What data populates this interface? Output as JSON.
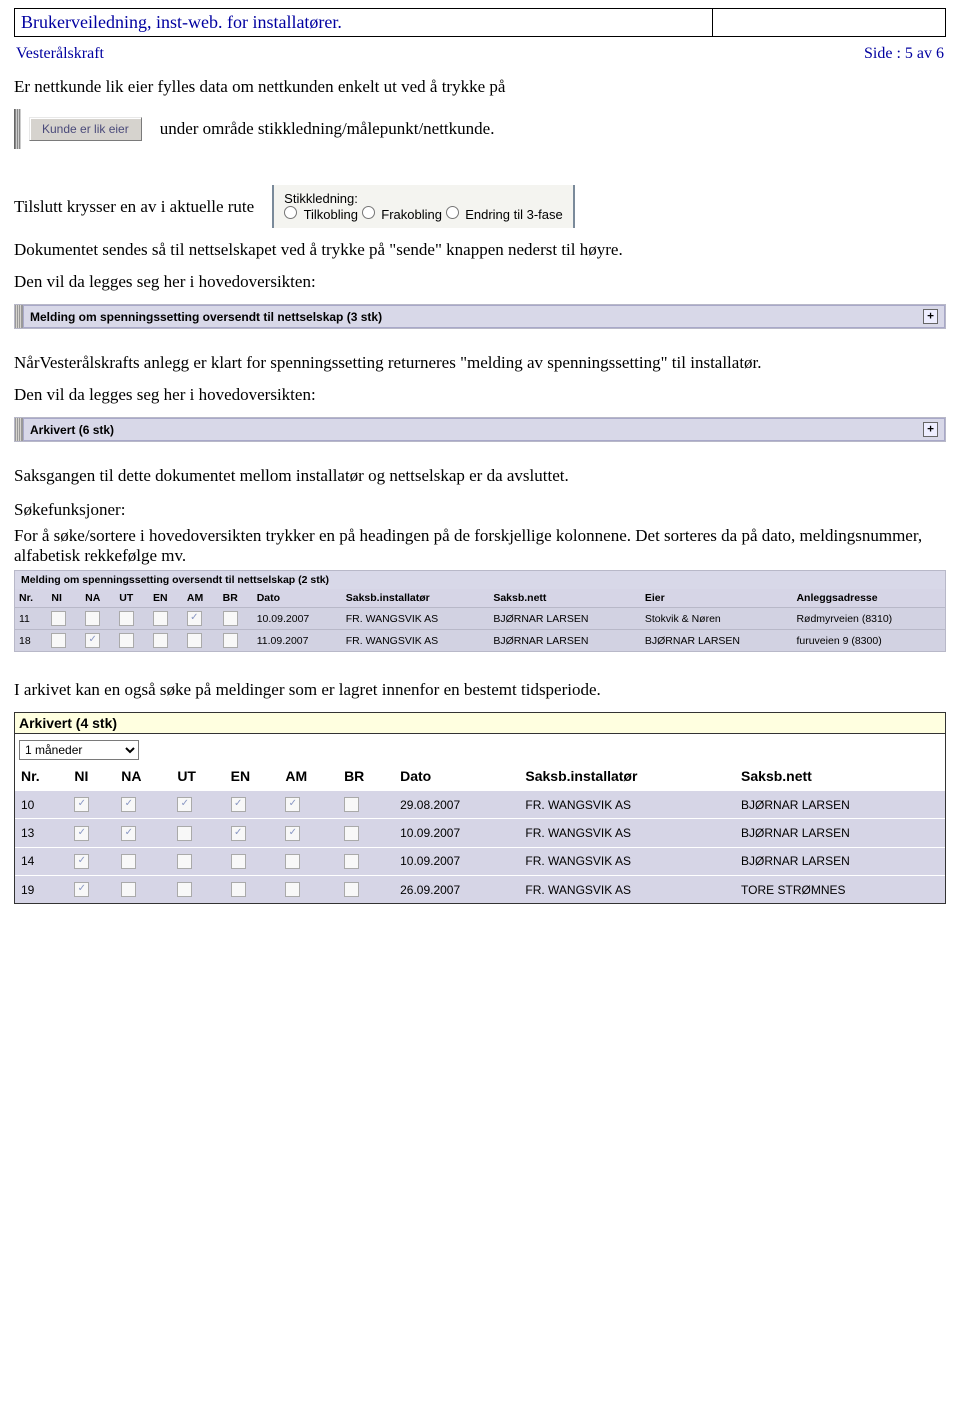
{
  "header": {
    "title": "Brukerveiledning, inst-web. for installatører.",
    "org": "Vesterålskraft",
    "page": "Side  : 5 av 6"
  },
  "body": {
    "p1": "Er nettkunde lik eier fylles data om nettkunden enkelt ut ved å trykke på",
    "button_label": "Kunde er lik eier",
    "p1b": "under område stikkledning/målepunkt/nettkunde.",
    "p2": "Tilslutt krysser en av i aktuelle rute",
    "stik": {
      "caption": "Stikkledning:",
      "o1": "Tilkobling",
      "o2": "Frakobling",
      "o3": "Endring til 3-fase"
    },
    "p3": "Dokumentet sendes så til nettselskapet ved å trykke på \"sende\" knappen nederst til høyre.",
    "p4": "Den vil da legges seg her i hovedoversikten:",
    "bar1": "Melding om spenningssetting oversendt til nettselskap (3 stk)",
    "p5": "NårVesterålskrafts anlegg er klart for spenningssetting returneres \"melding av spenningssetting\" til installatør.",
    "p6": "Den vil da legges seg her i hovedoversikten:",
    "bar2": "Arkivert (6 stk)",
    "p7": "Saksgangen til dette dokumentet mellom installatør og nettselskap er da avsluttet.",
    "h_search": "Søkefunksjoner:",
    "p8": "For å søke/sortere i hovedoversikten trykker en på headingen på de forskjellige kolonnene. Det sorteres da på dato, meldingsnummer, alfabetisk rekkefølge mv.",
    "table1": {
      "title": "Melding om spenningssetting oversendt til nettselskap (2 stk)",
      "cols": [
        "Nr.",
        "NI",
        "NA",
        "UT",
        "EN",
        "AM",
        "BR",
        "Dato",
        "Saksb.installatør",
        "Saksb.nett",
        "Eier",
        "Anleggsadresse"
      ],
      "rows": [
        {
          "nr": "11",
          "checks": [
            false,
            false,
            false,
            false,
            true,
            false
          ],
          "dato": "10.09.2007",
          "inst": "FR. WANGSVIK AS",
          "nett": "BJØRNAR LARSEN",
          "eier": "Stokvik & Nøren",
          "adr": "Rødmyrveien (8310)"
        },
        {
          "nr": "18",
          "checks": [
            false,
            true,
            false,
            false,
            false,
            false
          ],
          "dato": "11.09.2007",
          "inst": "FR. WANGSVIK AS",
          "nett": "BJØRNAR LARSEN",
          "eier": "BJØRNAR LARSEN",
          "adr": "furuveien 9 (8300)"
        }
      ]
    },
    "p9": "I arkivet kan en også søke på meldinger som er lagret innenfor en bestemt tidsperiode.",
    "archive": {
      "title": "Arkivert (4 stk)",
      "select": "1 måneder",
      "cols": [
        "Nr.",
        "NI",
        "NA",
        "UT",
        "EN",
        "AM",
        "BR",
        "Dato",
        "Saksb.installatør",
        "Saksb.nett"
      ],
      "rows": [
        {
          "nr": "10",
          "checks": [
            true,
            true,
            true,
            true,
            true,
            false
          ],
          "dato": "29.08.2007",
          "inst": "FR. WANGSVIK AS",
          "nett": "BJØRNAR LARSEN"
        },
        {
          "nr": "13",
          "checks": [
            true,
            true,
            false,
            true,
            true,
            false
          ],
          "dato": "10.09.2007",
          "inst": "FR. WANGSVIK AS",
          "nett": "BJØRNAR LARSEN"
        },
        {
          "nr": "14",
          "checks": [
            true,
            false,
            false,
            false,
            false,
            false
          ],
          "dato": "10.09.2007",
          "inst": "FR. WANGSVIK AS",
          "nett": "BJØRNAR LARSEN"
        },
        {
          "nr": "19",
          "checks": [
            true,
            false,
            false,
            false,
            false,
            false
          ],
          "dato": "26.09.2007",
          "inst": "FR. WANGSVIK AS",
          "nett": "TORE STRØMNES"
        }
      ]
    }
  }
}
